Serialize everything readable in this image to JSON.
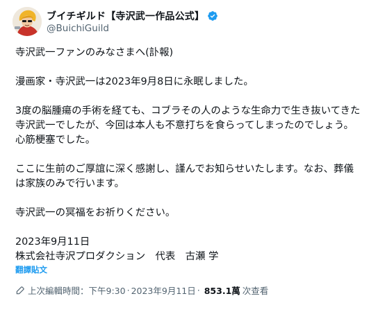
{
  "author": {
    "display_name": "ブイチギルド【寺沢武一作品公式】",
    "handle": "@BuichiGuild",
    "verified": true
  },
  "post": {
    "paragraphs": [
      "寺沢武一ファンのみなさまへ(訃報)",
      "漫画家・寺沢武一は2023年9月8日に永眠しました。",
      "3度の脳腫瘍の手術を経ても、コブラその人のような生命力で生き抜いてきた寺沢武一でしたが、今回は本人も不意打ちを食らってしまったのでしょう。心筋梗塞でした。",
      "ここに生前のご厚誼に深く感謝し、謹んでお知らせいたします。なお、葬儀は家族のみで行います。",
      "寺沢武一の冥福をお祈りください。",
      "2023年9月11日\n株式会社寺沢プロダクション　代表　古瀬 学"
    ],
    "translate_label": "翻譯貼文"
  },
  "meta": {
    "edited_label": "上次編輯時間：",
    "time": "下午9:30",
    "separator": "·",
    "date": "2023年9月11日",
    "views_count": "853.1萬",
    "views_label": "次查看"
  },
  "icons": {
    "verified": "verified-badge-icon",
    "edit": "pencil-icon"
  },
  "colors": {
    "accent": "#1d9bf0",
    "text": "#0f1419",
    "muted": "#536471"
  }
}
